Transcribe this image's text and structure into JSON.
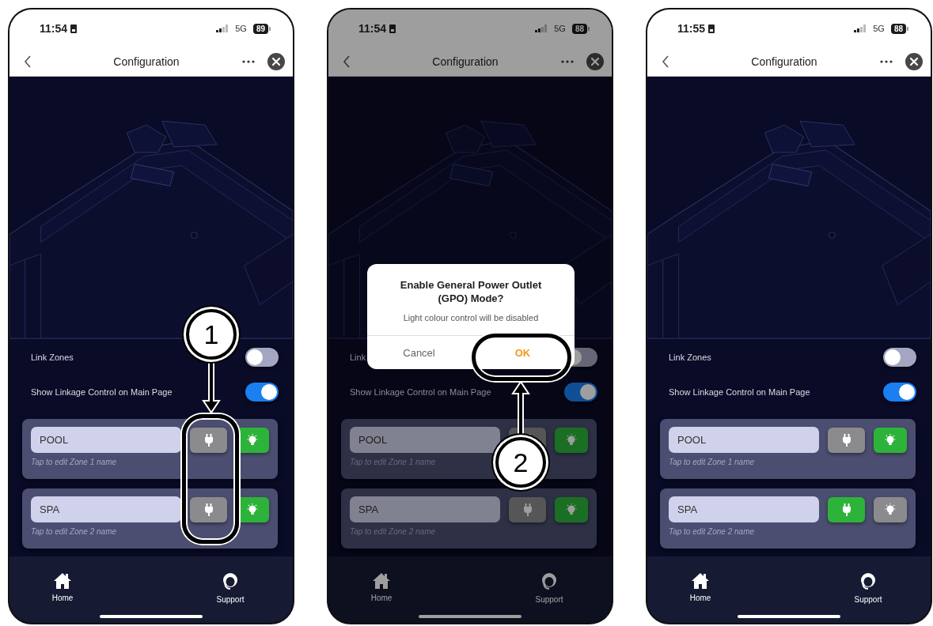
{
  "phones": [
    {
      "status_bar": {
        "time": "11:54",
        "network": "5G",
        "battery": "89"
      },
      "nav": {
        "title": "Configuration"
      },
      "dimmed": false,
      "toggles": [
        {
          "label": "Link Zones",
          "on": false
        },
        {
          "label": "Show Linkage Control on Main Page",
          "on": true
        }
      ],
      "zones": [
        {
          "name": "POOL",
          "hint": "Tap to edit Zone 1 name",
          "gpo": false,
          "light": true
        },
        {
          "name": "SPA",
          "hint": "Tap to edit Zone 2 name",
          "gpo": false,
          "light": true
        }
      ],
      "tabs": [
        {
          "label": "Home",
          "kind": "home"
        },
        {
          "label": "Support",
          "kind": "support"
        }
      ],
      "callout": {
        "number": "1",
        "kind": "gpo-column"
      }
    },
    {
      "status_bar": {
        "time": "11:54",
        "network": "5G",
        "battery": "88"
      },
      "nav": {
        "title": "Configuration"
      },
      "dimmed": true,
      "toggles": [
        {
          "label": "Link",
          "on": false
        },
        {
          "label": "Show Linkage Control on Main Page",
          "on": true
        }
      ],
      "zones": [
        {
          "name": "POOL",
          "hint": "Tap to edit Zone 1 name",
          "gpo": false,
          "light": true
        },
        {
          "name": "SPA",
          "hint": "Tap to edit Zone 2 name",
          "gpo": false,
          "light": true
        }
      ],
      "tabs": [
        {
          "label": "Home",
          "kind": "home"
        },
        {
          "label": "Support",
          "kind": "support"
        }
      ],
      "dialog": {
        "title": "Enable General Power Outlet (GPO) Mode?",
        "message": "Light colour control will be disabled",
        "buttons": [
          {
            "label": "Cancel",
            "kind": "cancel"
          },
          {
            "label": "OK",
            "kind": "confirm"
          }
        ]
      },
      "callout": {
        "number": "2",
        "kind": "dialog-ok"
      }
    },
    {
      "status_bar": {
        "time": "11:55",
        "network": "5G",
        "battery": "88"
      },
      "nav": {
        "title": "Configuration"
      },
      "dimmed": false,
      "toggles": [
        {
          "label": "Link Zones",
          "on": false
        },
        {
          "label": "Show Linkage Control on Main Page",
          "on": true
        }
      ],
      "zones": [
        {
          "name": "POOL",
          "hint": "Tap to edit Zone 1 name",
          "gpo": false,
          "light": true
        },
        {
          "name": "SPA",
          "hint": "Tap to edit Zone 2 name",
          "gpo": true,
          "light": false
        }
      ],
      "tabs": [
        {
          "label": "Home",
          "kind": "home"
        },
        {
          "label": "Support",
          "kind": "support"
        }
      ]
    }
  ]
}
